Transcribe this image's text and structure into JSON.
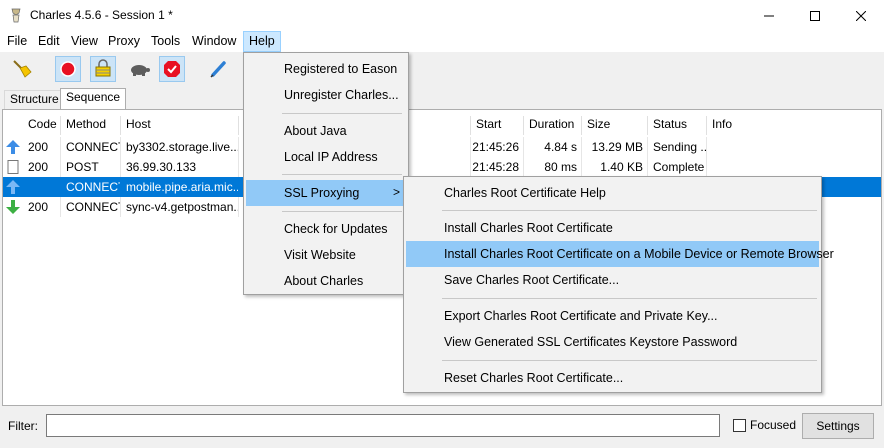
{
  "window": {
    "title": "Charles 4.5.6 - Session 1 *",
    "controls": {
      "minimize": "–",
      "maximize": "☐",
      "close": "✕"
    }
  },
  "menubar": [
    "File",
    "Edit",
    "View",
    "Proxy",
    "Tools",
    "Window",
    "Help"
  ],
  "tabs": [
    "Structure",
    "Sequence"
  ],
  "table": {
    "columns": [
      "Code",
      "Method",
      "Host",
      "Start",
      "Duration",
      "Size",
      "Status",
      "Info"
    ],
    "rows": [
      {
        "icon": "upload-arrow-icon",
        "code": "200",
        "method": "CONNECT",
        "host": "by3302.storage.live....",
        "path": "",
        "start": "21:45:26",
        "duration": "4.84 s",
        "size": "13.29 MB",
        "status": "Sending ...",
        "info": ""
      },
      {
        "icon": "blank-document-icon",
        "code": "200",
        "method": "POST",
        "host": "36.99.30.133",
        "path": "/",
        "start": "21:45:28",
        "duration": "80 ms",
        "size": "1.40 KB",
        "status": "Complete",
        "info": ""
      },
      {
        "icon": "upload-arrow-icon",
        "code": "",
        "method": "CONNECT",
        "host": "mobile.pipe.aria.mic...",
        "path": "",
        "start": "",
        "duration": "",
        "size": "",
        "status": "",
        "info": ""
      },
      {
        "icon": "download-arrow-icon",
        "code": "200",
        "method": "CONNECT",
        "host": "sync-v4.getpostman....",
        "path": "",
        "start": "",
        "duration": "",
        "size": "",
        "status": "",
        "info": ""
      }
    ]
  },
  "help_menu": {
    "items": [
      "Registered to Eason",
      "Unregister Charles...",
      "About Java",
      "Local IP Address",
      "SSL Proxying",
      "Check for Updates",
      "Visit Website",
      "About Charles"
    ],
    "submenu_arrow": ">"
  },
  "ssl_submenu": {
    "items": [
      "Charles Root Certificate Help",
      "Install Charles Root Certificate",
      "Install Charles Root Certificate on a Mobile Device or Remote Browser",
      "Save Charles Root Certificate...",
      "Export Charles Root Certificate and Private Key...",
      "View Generated SSL Certificates Keystore Password",
      "Reset Charles Root Certificate..."
    ]
  },
  "filter": {
    "label": "Filter:",
    "value": "",
    "focused_label": "Focused",
    "settings_label": "Settings"
  },
  "colors": {
    "selection": "#0078d7",
    "menu_highlight": "#91c9f7",
    "record": "#e81123"
  }
}
